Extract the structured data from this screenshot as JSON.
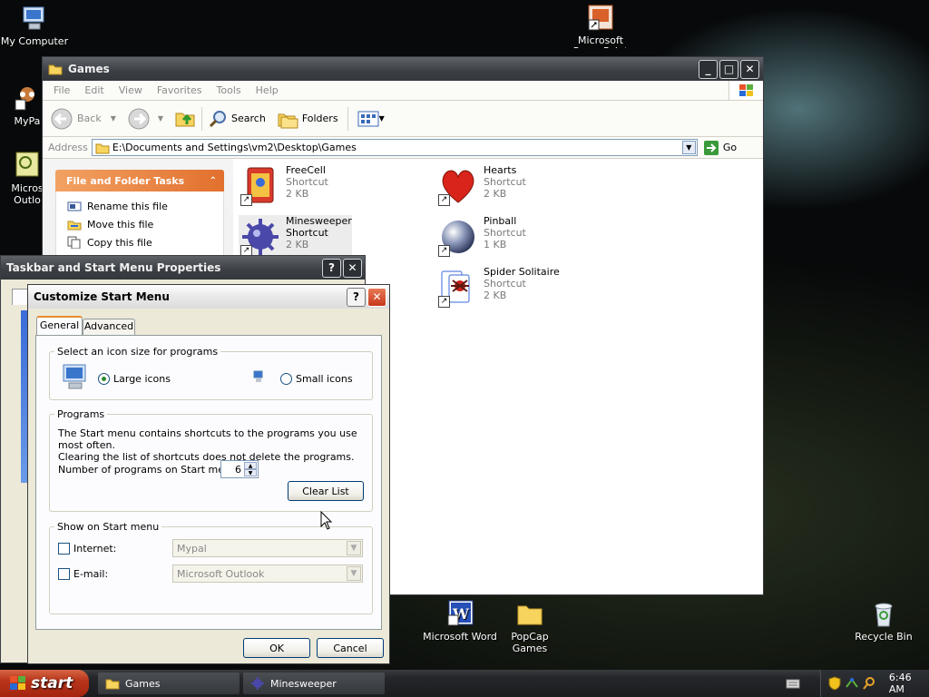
{
  "desktop": {
    "icons": [
      {
        "label": "My Computer"
      },
      {
        "label": "Microsoft PowerPoint"
      },
      {
        "label": "MyPa"
      },
      {
        "label": "Micros Outlo"
      },
      {
        "label": "Microsoft Word"
      },
      {
        "label": "PopCap Games"
      },
      {
        "label": "Recycle Bin"
      }
    ]
  },
  "explorer": {
    "title": "Games",
    "menu": [
      "File",
      "Edit",
      "View",
      "Favorites",
      "Tools",
      "Help"
    ],
    "toolbar": {
      "back": "Back",
      "search": "Search",
      "folders": "Folders"
    },
    "address_label": "Address",
    "address_value": "E:\\Documents and Settings\\vm2\\Desktop\\Games",
    "go_label": "Go",
    "tasks_title": "File and Folder Tasks",
    "tasks": [
      "Rename this file",
      "Move this file",
      "Copy this file"
    ],
    "files": [
      {
        "name": "FreeCell",
        "type": "Shortcut",
        "size": "2 KB"
      },
      {
        "name": "Hearts",
        "type": "Shortcut",
        "size": "2 KB"
      },
      {
        "name": "Minesweeper",
        "type": "Shortcut",
        "size": "2 KB"
      },
      {
        "name": "Pinball",
        "type": "Shortcut",
        "size": "1 KB"
      },
      {
        "name": "Spider Solitaire",
        "type": "Shortcut",
        "size": "2 KB"
      }
    ]
  },
  "taskbar_props": {
    "title": "Taskbar and Start Menu Properties",
    "help": "?",
    "close": "✕"
  },
  "customize": {
    "title": "Customize Start Menu",
    "help": "?",
    "close": "✕",
    "tabs": [
      "General",
      "Advanced"
    ],
    "icon_size": {
      "title": "Select an icon size for programs",
      "large": "Large icons",
      "small": "Small icons"
    },
    "programs": {
      "title": "Programs",
      "desc1": "The Start menu contains shortcuts to the programs you use most often.",
      "desc2": "Clearing the list of shortcuts does not delete the programs.",
      "count_label": "Number of programs on Start menu:",
      "count_value": "6",
      "clear_button": "Clear List"
    },
    "show": {
      "title": "Show on Start menu",
      "internet_label": "Internet:",
      "internet_value": "Mypal",
      "email_label": "E-mail:",
      "email_value": "Microsoft Outlook"
    },
    "ok": "OK",
    "cancel": "Cancel"
  },
  "taskbar": {
    "start": "start",
    "tasks": [
      "Games",
      "Minesweeper"
    ],
    "clock": "6:46 AM"
  }
}
